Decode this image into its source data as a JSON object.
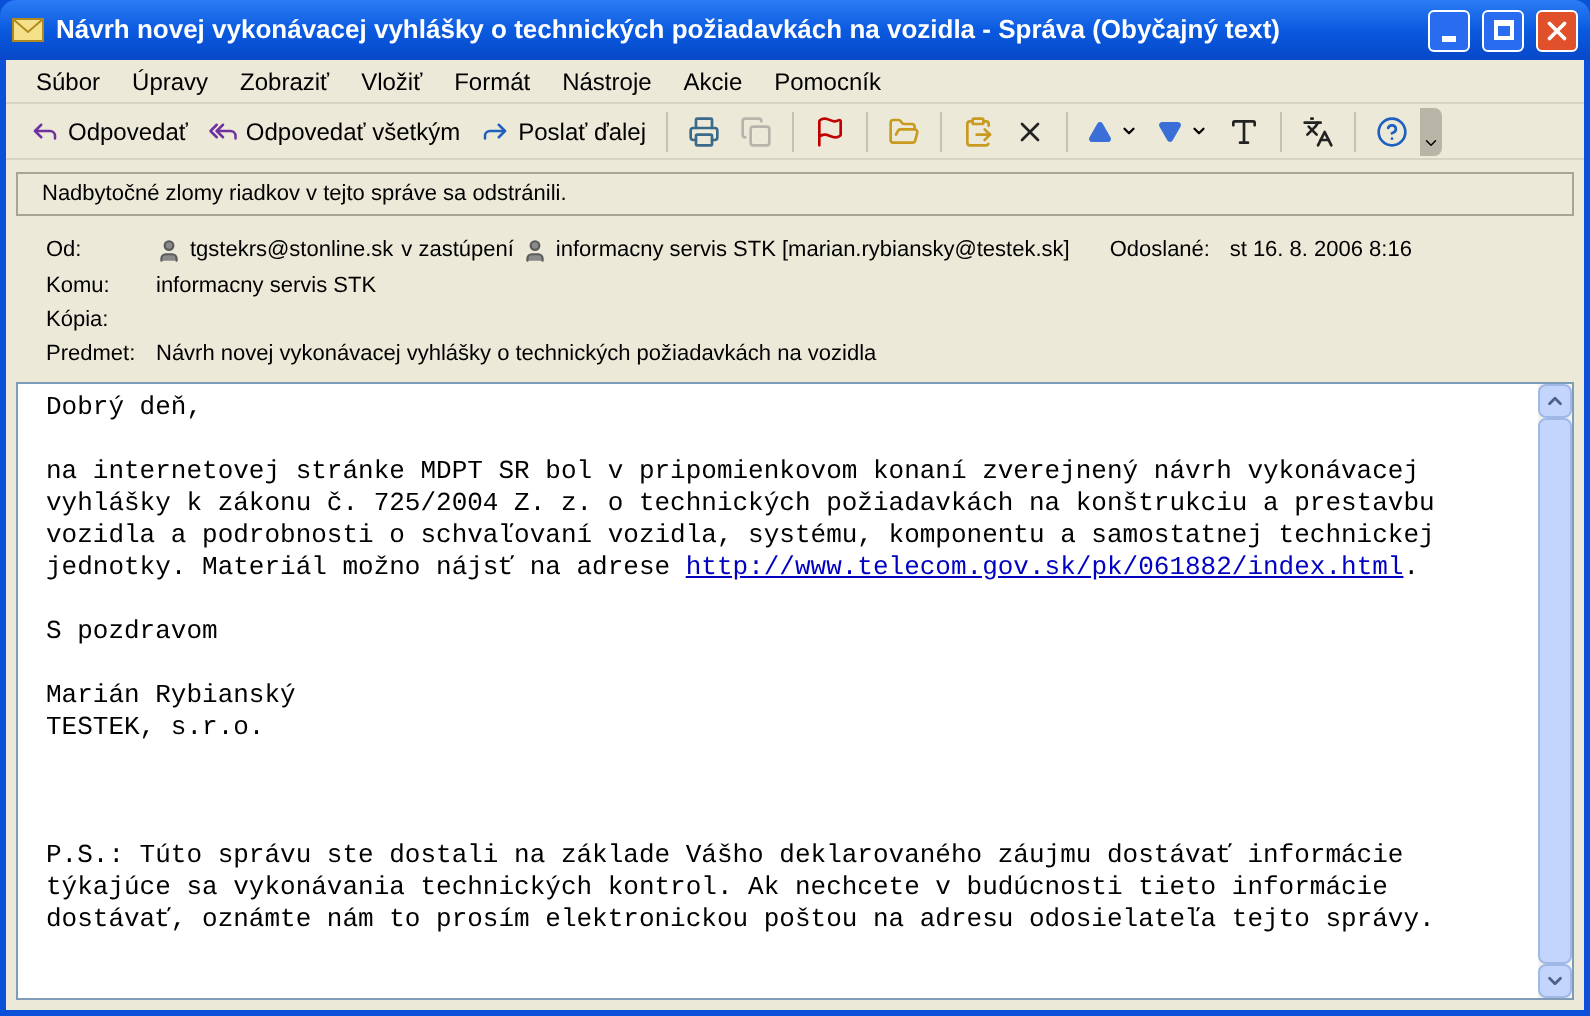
{
  "window": {
    "title": "Návrh novej vykonávacej vyhlášky o technických požiadavkách na vozidla - Správa (Obyčajný text)"
  },
  "menu": [
    "Súbor",
    "Úpravy",
    "Zobraziť",
    "Vložiť",
    "Formát",
    "Nástroje",
    "Akcie",
    "Pomocník"
  ],
  "toolbar": [
    {
      "kind": "reply",
      "label": "Odpovedať",
      "disabled": false
    },
    {
      "kind": "replyall",
      "label": "Odpovedať všetkým",
      "disabled": false
    },
    {
      "kind": "forward",
      "label": "Poslať ďalej",
      "disabled": false
    },
    {
      "kind": "separator"
    },
    {
      "kind": "print",
      "disabled": false
    },
    {
      "kind": "copy",
      "disabled": true
    },
    {
      "kind": "separator"
    },
    {
      "kind": "flag",
      "disabled": false
    },
    {
      "kind": "separator"
    },
    {
      "kind": "folder",
      "disabled": false
    },
    {
      "kind": "separator"
    },
    {
      "kind": "move",
      "disabled": false
    },
    {
      "kind": "delete",
      "disabled": false
    },
    {
      "kind": "separator"
    },
    {
      "kind": "previous",
      "disabled": false
    },
    {
      "kind": "next",
      "disabled": false
    },
    {
      "kind": "fontsize",
      "disabled": false
    },
    {
      "kind": "separator"
    },
    {
      "kind": "encoding",
      "disabled": false
    },
    {
      "kind": "separator"
    },
    {
      "kind": "help",
      "disabled": false
    },
    {
      "kind": "overflow"
    }
  ],
  "info_bar": "Nadbytočné zlomy riadkov v tejto správe sa odstránili.",
  "header": {
    "from": {
      "label": "Od:",
      "parts": [
        {
          "kind": "contact",
          "text": "tgstekrs@stonline.sk"
        },
        {
          "kind": "text",
          "text": "v zastúpení"
        },
        {
          "kind": "contact",
          "text": "informacny servis STK [marian.rybiansky@testek.sk]"
        }
      ]
    },
    "sent": {
      "label": "Odoslané:",
      "value": "st 16. 8. 2006 8:16"
    },
    "fields": [
      {
        "label": "Komu:",
        "value": "informacny servis STK"
      },
      {
        "label": "Kópia:"
      },
      {
        "label": "Predmet:",
        "value": "Návrh novej vykonávacej vyhlášky o technických požiadavkách na vozidla"
      }
    ]
  },
  "body": [
    {
      "lines": [
        "Dobrý deň,"
      ]
    },
    {
      "lines": [
        "na internetovej stránke MDPT SR bol v pripomienkovom konaní zverejnený návrh vykonávacej",
        "vyhlášky k zákonu č. 725/2004 Z. z. o technických požiadavkách na konštrukciu a prestavbu",
        "vozidla a podrobnosti o schvaľovaní vozidla, systému, komponentu a samostatnej technickej",
        "jednotky. Materiál možno nájsť na adrese "
      ],
      "link": "http://www.telecom.gov.sk/pk/061882/index.html",
      "after": "."
    },
    {
      "lines": [
        "S pozdravom"
      ]
    },
    {
      "lines": [
        "Marián Rybianský",
        "TESTEK, s.r.o."
      ]
    },
    {
      "kind": "postscript",
      "lines": [
        "P.S.: Túto správu ste dostali na základe Vášho deklarovaného záujmu dostávať informácie",
        "týkajúce sa vykonávania technických kontrol. Ak nechcete v budúcnosti tieto informácie",
        "dostávať, oznámte nám to prosím elektronickou poštou na adresu odosielateľa tejto správy."
      ]
    }
  ]
}
